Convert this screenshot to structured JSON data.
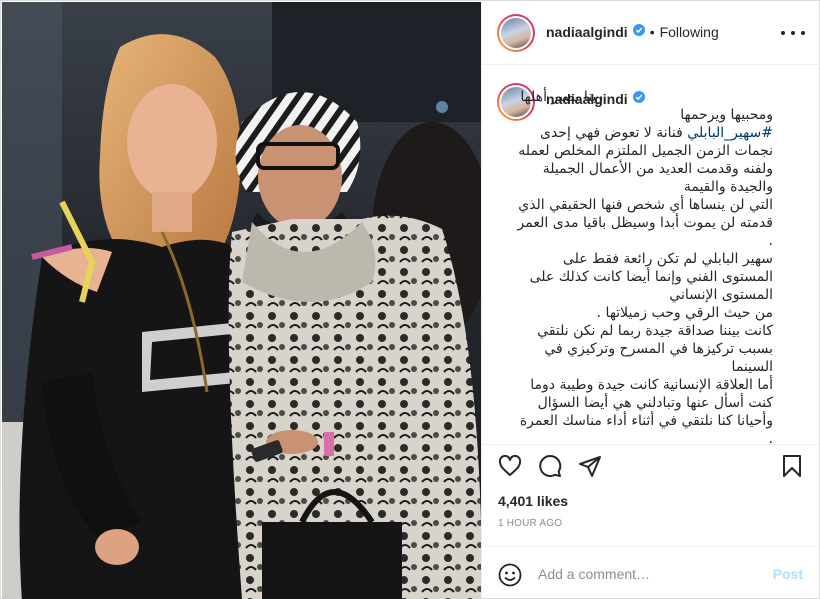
{
  "header": {
    "username": "nadiaalgindi",
    "separator": "•",
    "follow_status": "Following",
    "more_icon": "more-horizontal-icon"
  },
  "caption": {
    "username": "nadiaalgindi",
    "text_before_tag": "ربنا يصبر أهلها ومحبيها ويرحمها\n",
    "hashtag": "#سهير_البابلي",
    "text_after_tag": " فنانة لا تعوض فهي إحدى نجمات الزمن الجميل الملتزم المخلص لعمله ولفنه وقدمت العديد من الأعمال الجميلة والجيدة والقيمة\nالتي لن ينساها أي شخص فنها الحقيقي الذي قدمته لن يموت أبدا وسيظل باقيا مدى العمر\n.\nسهير البابلي لم تكن رائعة فقط على المستوى الفني وإنما أيضا كانت كذلك على المستوى الإنساني\nمن حيث الرقي وحب زميلاتها .\nكانت بيننا صداقة جيدة ربما لم نكن نلتقي بسبب تركيزها في المسرح وتركيزي في السينما\nأما العلاقة الإنسانية كانت جيدة وطيبة دوما\nكنت أسأل عنها وتبادلني هي أيضا السؤال\nوأحيانا كنا نلتقي في أثناء أداء مناسك العمرة ."
  },
  "actions": {
    "like_icon": "heart-icon",
    "comment_icon": "comment-icon",
    "share_icon": "share-icon",
    "save_icon": "bookmark-icon"
  },
  "likes": "4,401 likes",
  "timestamp": "1 HOUR AGO",
  "comment_box": {
    "placeholder": "Add a comment…",
    "post_label": "Post",
    "emoji_icon": "emoji-icon"
  },
  "colors": {
    "verified_blue": "#3897f0",
    "hashtag_blue": "#00376b",
    "post_button_disabled": "#b2dffc",
    "muted_gray": "#8e8e8e"
  }
}
